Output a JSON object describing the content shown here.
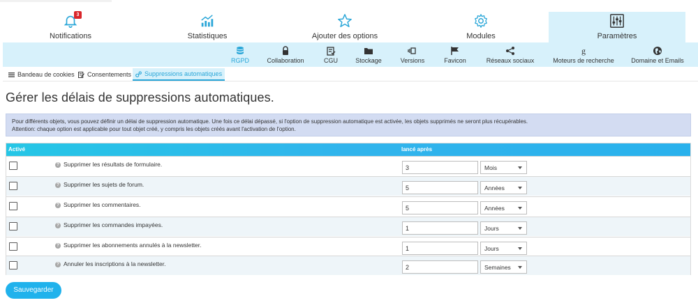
{
  "main_tabs": [
    {
      "label": "Notifications",
      "icon": "bell-icon",
      "badge": "3"
    },
    {
      "label": "Statistiques",
      "icon": "chart-icon"
    },
    {
      "label": "Ajouter des options",
      "icon": "star-icon"
    },
    {
      "label": "Modules",
      "icon": "gear-icon"
    },
    {
      "label": "Paramètres",
      "icon": "sliders-icon",
      "active": true
    }
  ],
  "sub_tabs": [
    {
      "label": "RGPD",
      "icon": "database-icon",
      "active": true
    },
    {
      "label": "Collaboration",
      "icon": "lock-icon"
    },
    {
      "label": "CGU",
      "icon": "checklist-icon"
    },
    {
      "label": "Stockage",
      "icon": "folder-icon"
    },
    {
      "label": "Versions",
      "icon": "versions-icon"
    },
    {
      "label": "Favicon",
      "icon": "flag-icon"
    },
    {
      "label": "Réseaux sociaux",
      "icon": "share-icon"
    },
    {
      "label": "Moteurs de recherche",
      "icon": "google-icon"
    },
    {
      "label": "Domaine et Emails",
      "icon": "globe-icon"
    }
  ],
  "tert_tabs": [
    {
      "label": "Bandeau de cookies",
      "icon": "list-icon"
    },
    {
      "label": "Consentements",
      "icon": "edit-icon"
    },
    {
      "label": "Suppressions automatiques",
      "icon": "nodes-icon",
      "active": true
    }
  ],
  "page_title": "Gérer les délais de suppressions automatiques.",
  "info": {
    "line1": "Pour différents objets, vous pouvez définir un délai de suppression automatique. Une fois ce délai dépassé, si l'option de suppression automatique est activée, les objets supprimés ne seront plus récupérables.",
    "line2": "Attention: chaque option est applicable pour tout objet créé, y compris les objets créés avant l'activation de l'option."
  },
  "table": {
    "col_active": "Activé",
    "col_after": "lancé après",
    "help_glyph": "?",
    "rows": [
      {
        "label": "Supprimer les résultats de formulaire.",
        "value": "3",
        "unit": "Mois"
      },
      {
        "label": "Supprimer les sujets de forum.",
        "value": "5",
        "unit": "Années"
      },
      {
        "label": "Supprimer les commentaires.",
        "value": "5",
        "unit": "Années"
      },
      {
        "label": "Supprimer les commandes impayées.",
        "value": "1",
        "unit": "Jours"
      },
      {
        "label": "Supprimer les abonnements annulés à la newsletter.",
        "value": "1",
        "unit": "Jours"
      },
      {
        "label": "Annuler les inscriptions à la newsletter.",
        "value": "2",
        "unit": "Semaines"
      }
    ]
  },
  "save_label": "Sauvegarder",
  "colors": {
    "accent": "#29a6d8",
    "tab_bg": "#d7f1fb",
    "badge": "#d9262b",
    "button": "#20b2ec"
  }
}
